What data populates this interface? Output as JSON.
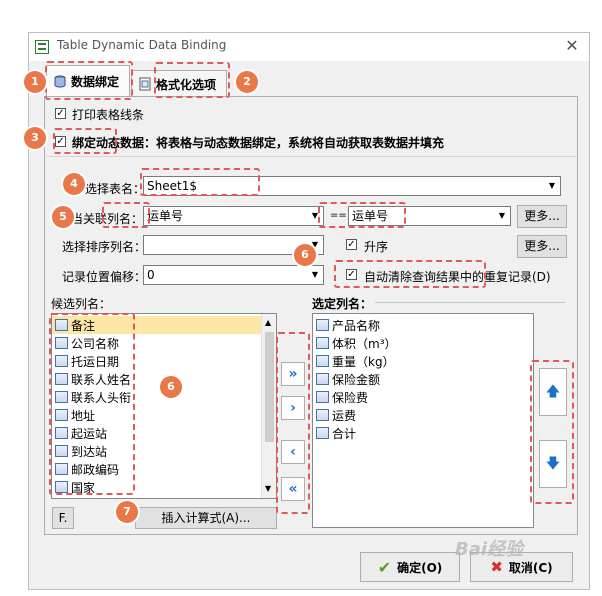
{
  "window": {
    "title": "Table Dynamic Data Binding",
    "close_glyph": "✕"
  },
  "tabs": [
    {
      "label": "数据绑定",
      "active": true,
      "icon": "database-icon"
    },
    {
      "label": "格式化选项",
      "active": false,
      "icon": "format-doc-icon"
    }
  ],
  "options": {
    "print_gridlines_label": "打印表格线条",
    "print_gridlines_checked": true,
    "bind_dynamic_label": "绑定动态数据：将表格与动态数据绑定，系统将自动获取表数据并填充",
    "bind_dynamic_checked": true
  },
  "form": {
    "select_table_label": "选择表名：",
    "select_table_value": "Sheet1$",
    "related_column_label": "当关联列名：",
    "related_column_value": "运单号",
    "equals": "==",
    "related_target_value": "运单号",
    "more_label_1": "更多...",
    "sort_column_label": "选择排序列名：",
    "sort_column_value": "",
    "ascending_label": "升序",
    "ascending_checked": true,
    "more_label_2": "更多...",
    "offset_label": "记录位置偏移：",
    "offset_value": "0",
    "auto_clear_label": "自动清除查询结果中的重复记录(D)",
    "auto_clear_checked": true
  },
  "candidates": {
    "title": "候选列名：",
    "items": [
      "备注",
      "公司名称",
      "托运日期",
      "联系人姓名",
      "联系人头衔",
      "地址",
      "起运站",
      "到达站",
      "邮政编码",
      "国家"
    ],
    "selected_index": 0
  },
  "selected_columns": {
    "title": "选定列名：",
    "items": [
      "产品名称",
      "体积（m³）",
      "重量（kg）",
      "保险金额",
      "保险费",
      "运费",
      "合计"
    ]
  },
  "transfer_buttons": [
    {
      "glyph": "»",
      "name": "move-all-right-button"
    },
    {
      "glyph": "›",
      "name": "move-right-button"
    },
    {
      "glyph": "‹",
      "name": "move-left-button"
    },
    {
      "glyph": "«",
      "name": "move-all-left-button"
    }
  ],
  "order_buttons": {
    "up_glyph": "🡅",
    "down_glyph": "🡇"
  },
  "bottom": {
    "f_button": "F.",
    "insert_formula_button": "插入计算式(A)...",
    "ok_button": "确定(O)",
    "cancel_button": "取消(C)"
  },
  "annotations": [
    "1",
    "2",
    "3",
    "4",
    "5",
    "6",
    "6",
    "7"
  ],
  "watermark": "Bai经验",
  "colors": {
    "annotation_badge": "#e8774a",
    "dash_border": "#e05a5a",
    "accent_blue": "#1e6fc9",
    "selected_row": "#fde6a6"
  }
}
